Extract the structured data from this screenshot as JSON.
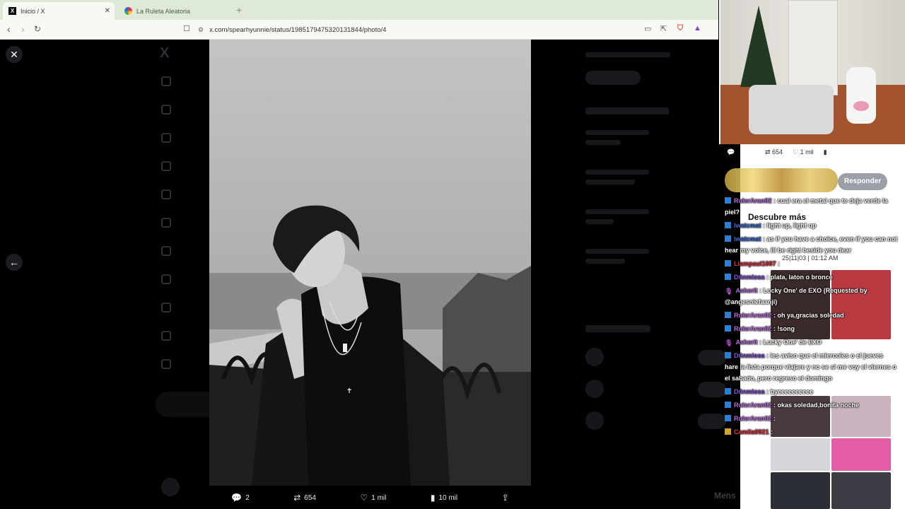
{
  "browser": {
    "tabs": [
      {
        "label": "Inicio / X",
        "active": true,
        "icon": "x-logo-icon"
      },
      {
        "label": "La Ruleta Aleatoria",
        "active": false,
        "icon": "wheel-icon"
      }
    ],
    "new_tab_label": "+",
    "url": "x.com/spearhyunnie/status/1985179475320131844/photo/4"
  },
  "viewer": {
    "close_label": "✕",
    "back_label": "←",
    "actions": {
      "replies": "2",
      "reposts": "654",
      "likes": "1 mil",
      "views": "10 mil"
    }
  },
  "right_panel": {
    "reply_button": "Responder",
    "stats": {
      "reposts": "654",
      "likes": "1 mil"
    },
    "discover_heading": "Descubre más",
    "post_date": "25|11|03 | 01:12 AM",
    "footer_label": "Mens"
  },
  "chat": [
    {
      "badge": "twitter",
      "user": "RulerAran02",
      "user_color": "#b56bd8",
      "text": "cual era el metal que te deja verde la piel?"
    },
    {
      "badge": "twitter",
      "user": "lwatcmat",
      "user_color": "#3b6ad6",
      "text": "light up, light up"
    },
    {
      "badge": "twitter",
      "user": "lwatcmat",
      "user_color": "#3b6ad6",
      "text": "as if you have a choice, even if you can not hear my voice, ill be right beside you dear"
    },
    {
      "badge": "twitter",
      "user": "Liampaul1007",
      "user_color": "#e0333f",
      "text": ""
    },
    {
      "badge": "twitter",
      "user": "Dñnmiosa",
      "user_color": "#7f54d6",
      "text": "plata, laton o bronce"
    },
    {
      "badge": "mic",
      "user": "Asherit",
      "user_color": "#b56bd8",
      "text": "Lucky One' de EXO (Requested by @angesniefaanji)"
    },
    {
      "badge": "twitter",
      "user": "RulerAran02",
      "user_color": "#b56bd8",
      "text": "oh ya,gracias soledad"
    },
    {
      "badge": "twitter",
      "user": "RulerAran02",
      "user_color": "#b56bd8",
      "text": "!song"
    },
    {
      "badge": "mic",
      "user": "Asherit",
      "user_color": "#b56bd8",
      "text": "Lucky One' de EXO"
    },
    {
      "badge": "twitter",
      "user": "Dñnmiosa",
      "user_color": "#7f54d6",
      "text": "les aviso que el miercoles o el jueves hare la lista porque viajare y no se si me voy el viernes o el sabado, pero regreso el domingo"
    },
    {
      "badge": "twitter",
      "user": "Dñnmiosa",
      "user_color": "#7f54d6",
      "text": "byeeeeeeeeee"
    },
    {
      "badge": "twitter",
      "user": "RulerAran02",
      "user_color": "#b56bd8",
      "text": "okas soledad,bonita noche"
    },
    {
      "badge": "twitter",
      "user": "RulerAran02",
      "user_color": "#b56bd8",
      "text": ""
    },
    {
      "badge": "crown",
      "user": "Camila0921",
      "user_color": "#e0333f",
      "text": ""
    }
  ],
  "colors": {
    "accent": "#1d9bf0",
    "tabbar": "#dfe9d8",
    "toolbar": "#f7f9f5"
  }
}
